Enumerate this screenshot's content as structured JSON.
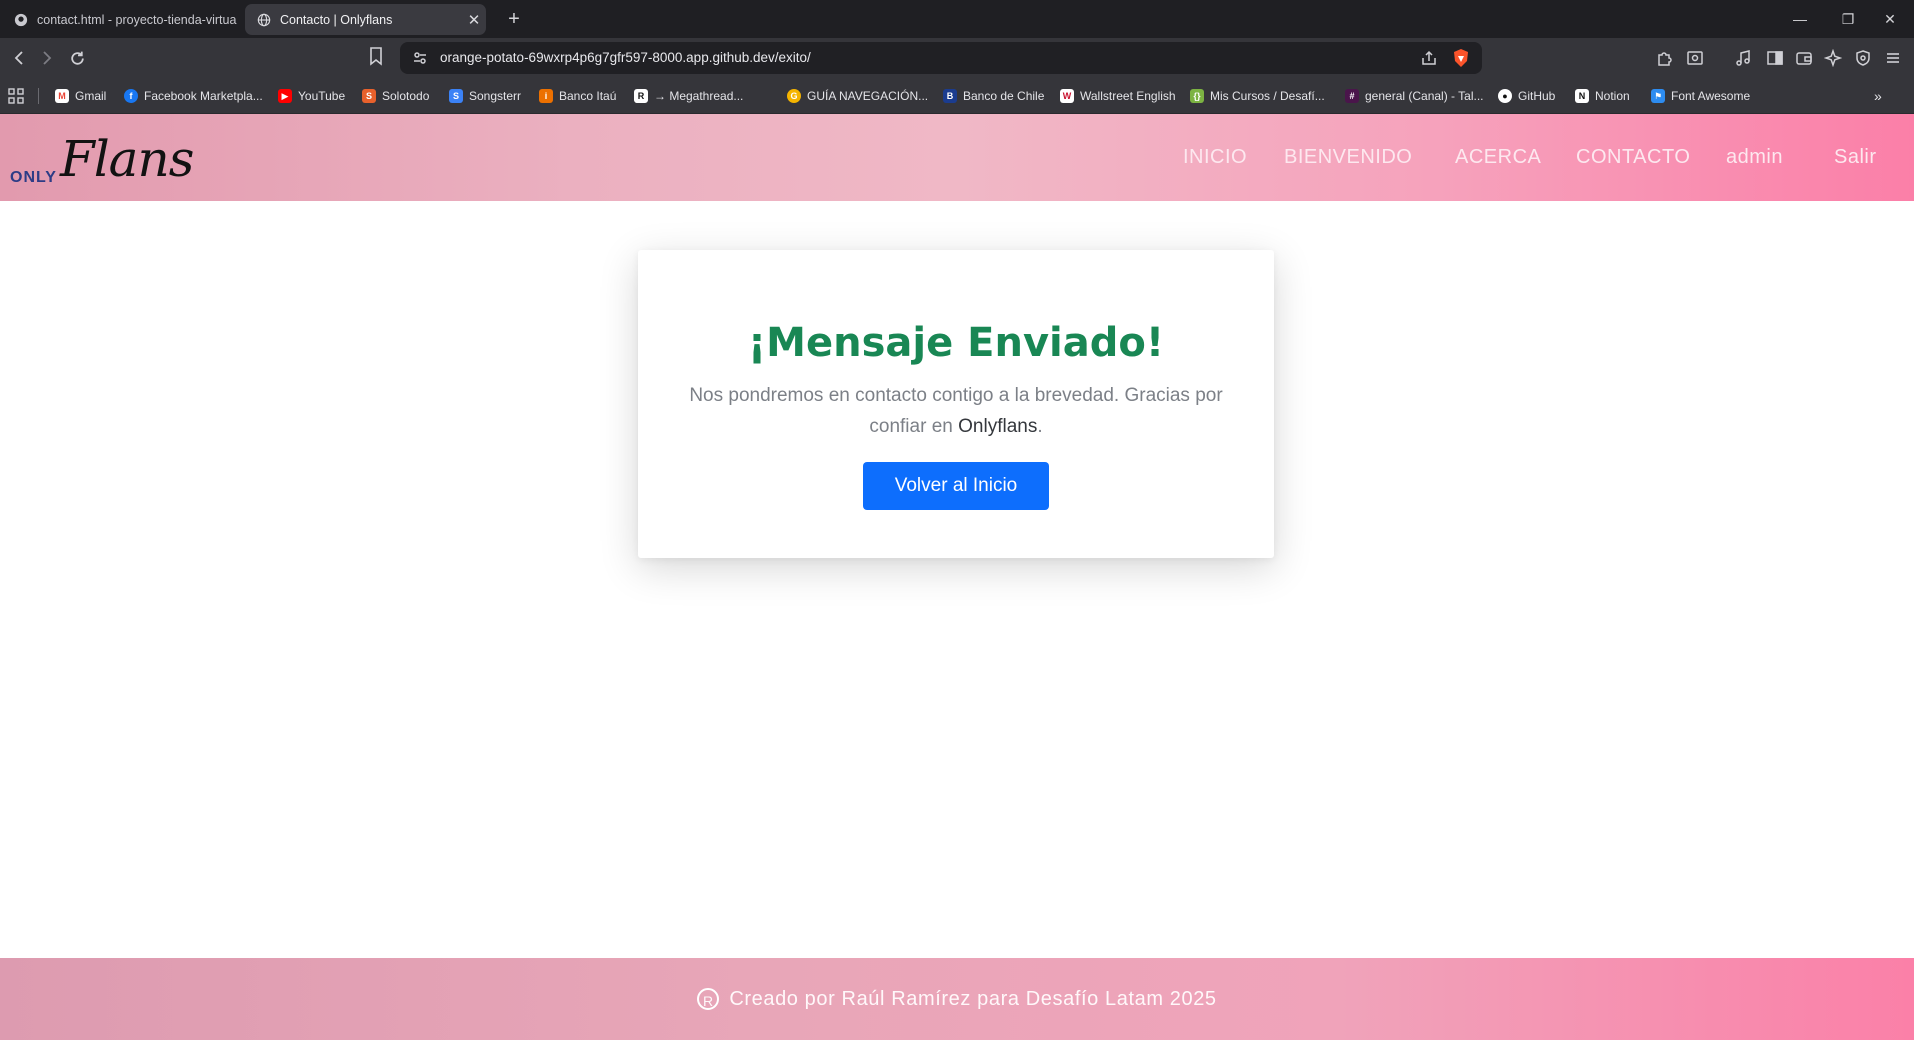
{
  "browser": {
    "tabs": [
      {
        "title": "contact.html - proyecto-tienda-virtua",
        "active": false
      },
      {
        "title": "Contacto | Onlyflans",
        "active": true
      }
    ],
    "url": "orange-potato-69wxrp4p6g7gfr597-8000.app.github.dev/exito/",
    "bookmarks": [
      {
        "label": "Gmail",
        "icon": "gmail-icon",
        "color": "#ea4335"
      },
      {
        "label": "Facebook Marketpla...",
        "icon": "facebook-icon",
        "color": "#1877f2"
      },
      {
        "label": "YouTube",
        "icon": "youtube-icon",
        "color": "#ff0000"
      },
      {
        "label": "Solotodo",
        "icon": "solotodo-icon",
        "color": "#e8612c"
      },
      {
        "label": "Songsterr",
        "icon": "songsterr-icon",
        "color": "#3b82f6"
      },
      {
        "label": "Banco Itaú",
        "icon": "itau-icon",
        "color": "#ec7000"
      },
      {
        "label": "→ Megathread...",
        "icon": "reddit-icon",
        "color": "#ffffff"
      },
      {
        "label": "GUÍA NAVEGACIÓN...",
        "icon": "guide-icon",
        "color": "#f5b400"
      },
      {
        "label": "Banco de Chile",
        "icon": "bancochile-icon",
        "color": "#1b3c8f"
      },
      {
        "label": "Wallstreet English",
        "icon": "wallstreet-icon",
        "color": "#c8102e"
      },
      {
        "label": "Mis Cursos / Desafí...",
        "icon": "cursos-icon",
        "color": "#7cb342"
      },
      {
        "label": "general (Canal) - Tal...",
        "icon": "slack-icon",
        "color": "#e01e5a"
      },
      {
        "label": "GitHub",
        "icon": "github-icon",
        "color": "#ffffff"
      },
      {
        "label": "Notion",
        "icon": "notion-icon",
        "color": "#ffffff"
      },
      {
        "label": "Font Awesome",
        "icon": "fontawesome-icon",
        "color": "#2d8cf0"
      }
    ]
  },
  "site": {
    "logo": {
      "only": "ONLY",
      "flans": "Flans"
    },
    "nav": [
      "INICIO",
      "BIENVENIDO",
      "ACERCA",
      "CONTACTO",
      "admin",
      "Salir"
    ]
  },
  "card": {
    "heading": "¡Mensaje Enviado!",
    "message_part1": "Nos pondremos en contacto contigo a la brevedad. Gracias por confiar en ",
    "brand": "Onlyflans",
    "message_part2": ".",
    "button": "Volver al Inicio"
  },
  "footer": {
    "symbol": "R",
    "text": "Creado por Raúl Ramírez para Desafío Latam 2025"
  },
  "colors": {
    "heading": "#198754",
    "button": "#0d6efd",
    "header_start": "#e29aae",
    "header_end": "#fb7fa8"
  }
}
